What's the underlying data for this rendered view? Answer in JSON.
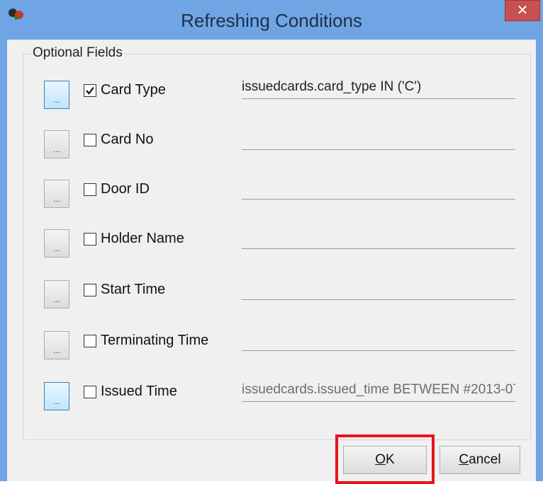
{
  "window": {
    "title": "Refreshing Conditions",
    "close_glyph": "✕",
    "icon": "app-icon",
    "titlebar_color": "#6fa5e4"
  },
  "group": {
    "title": "Optional Fields"
  },
  "rows": [
    {
      "label": "Card Type",
      "checked": true,
      "condition": "issuedcards.card_type IN ('C')",
      "button": "..."
    },
    {
      "label": "Card No",
      "checked": false,
      "condition": "",
      "button": "..."
    },
    {
      "label": "Door ID",
      "checked": false,
      "condition": "",
      "button": "..."
    },
    {
      "label": "Holder Name",
      "checked": false,
      "condition": "",
      "button": "..."
    },
    {
      "label": "Start Time",
      "checked": false,
      "condition": "",
      "button": "..."
    },
    {
      "label": "Terminating Time",
      "checked": false,
      "condition": "",
      "button": "..."
    },
    {
      "label": "Issued Time",
      "checked": false,
      "condition": "issuedcards.issued_time BETWEEN #2013-07",
      "button": "..."
    }
  ],
  "buttons": {
    "ok_mnemonic": "O",
    "ok_rest": "K",
    "cancel_mnemonic": "C",
    "cancel_rest": "ancel"
  },
  "annotation": {
    "highlight_color": "#e8141c",
    "target": "ok-button"
  }
}
